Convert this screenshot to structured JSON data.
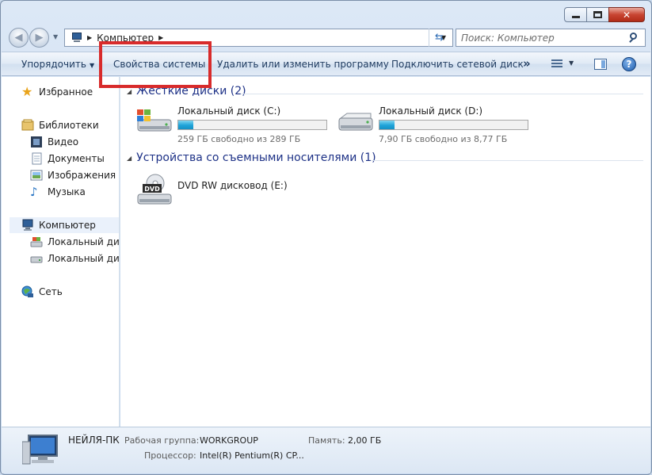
{
  "window": {
    "caption_buttons": {
      "minimize": "minimize-icon",
      "maximize": "maximize-icon",
      "close": "close-icon",
      "close_glyph": "✕"
    }
  },
  "navigation": {
    "back_glyph": "◀",
    "forward_glyph": "▶",
    "address": {
      "breadcrumb": "Компьютер",
      "icon": "computer-icon"
    },
    "search": {
      "placeholder": "Поиск: Компьютер"
    }
  },
  "command_bar": {
    "organize": "Упорядочить",
    "system_properties": "Свойства системы",
    "uninstall": "Удалить или изменить программу",
    "map_drive": "Подключить сетевой диск",
    "overflow": "»",
    "help": "?"
  },
  "highlight_color": "#d82b2b",
  "sidebar": {
    "favorites": "Избранное",
    "libraries": {
      "label": "Библиотеки",
      "items": [
        "Видео",
        "Документы",
        "Изображения",
        "Музыка"
      ]
    },
    "computer": {
      "label": "Компьютер",
      "items": [
        "Локальный диск",
        "Локальный диск"
      ]
    },
    "network": "Сеть"
  },
  "groups": {
    "hard_drives": {
      "title": "Жесткие диски (2)"
    },
    "removable": {
      "title": "Устройства со съемными носителями (1)"
    }
  },
  "drives": [
    {
      "name": "Локальный диск (C:)",
      "free_text": "259 ГБ свободно из 289 ГБ",
      "used_fraction": 0.1,
      "system": true
    },
    {
      "name": "Локальный диск (D:)",
      "free_text": "7,90 ГБ свободно из 8,77 ГБ",
      "used_fraction": 0.1,
      "system": false
    }
  ],
  "removable_devices": [
    {
      "name": "DVD RW дисковод (E:)",
      "badge": "DVD"
    }
  ],
  "details": {
    "computer_name": "НЕЙЛЯ-ПК",
    "workgroup_label": "Рабочая группа:",
    "workgroup_value": "WORKGROUP",
    "memory_label": "Память:",
    "memory_value": "2,00 ГБ",
    "processor_label": "Процессор:",
    "processor_value": "Intel(R) Pentium(R) CP..."
  }
}
